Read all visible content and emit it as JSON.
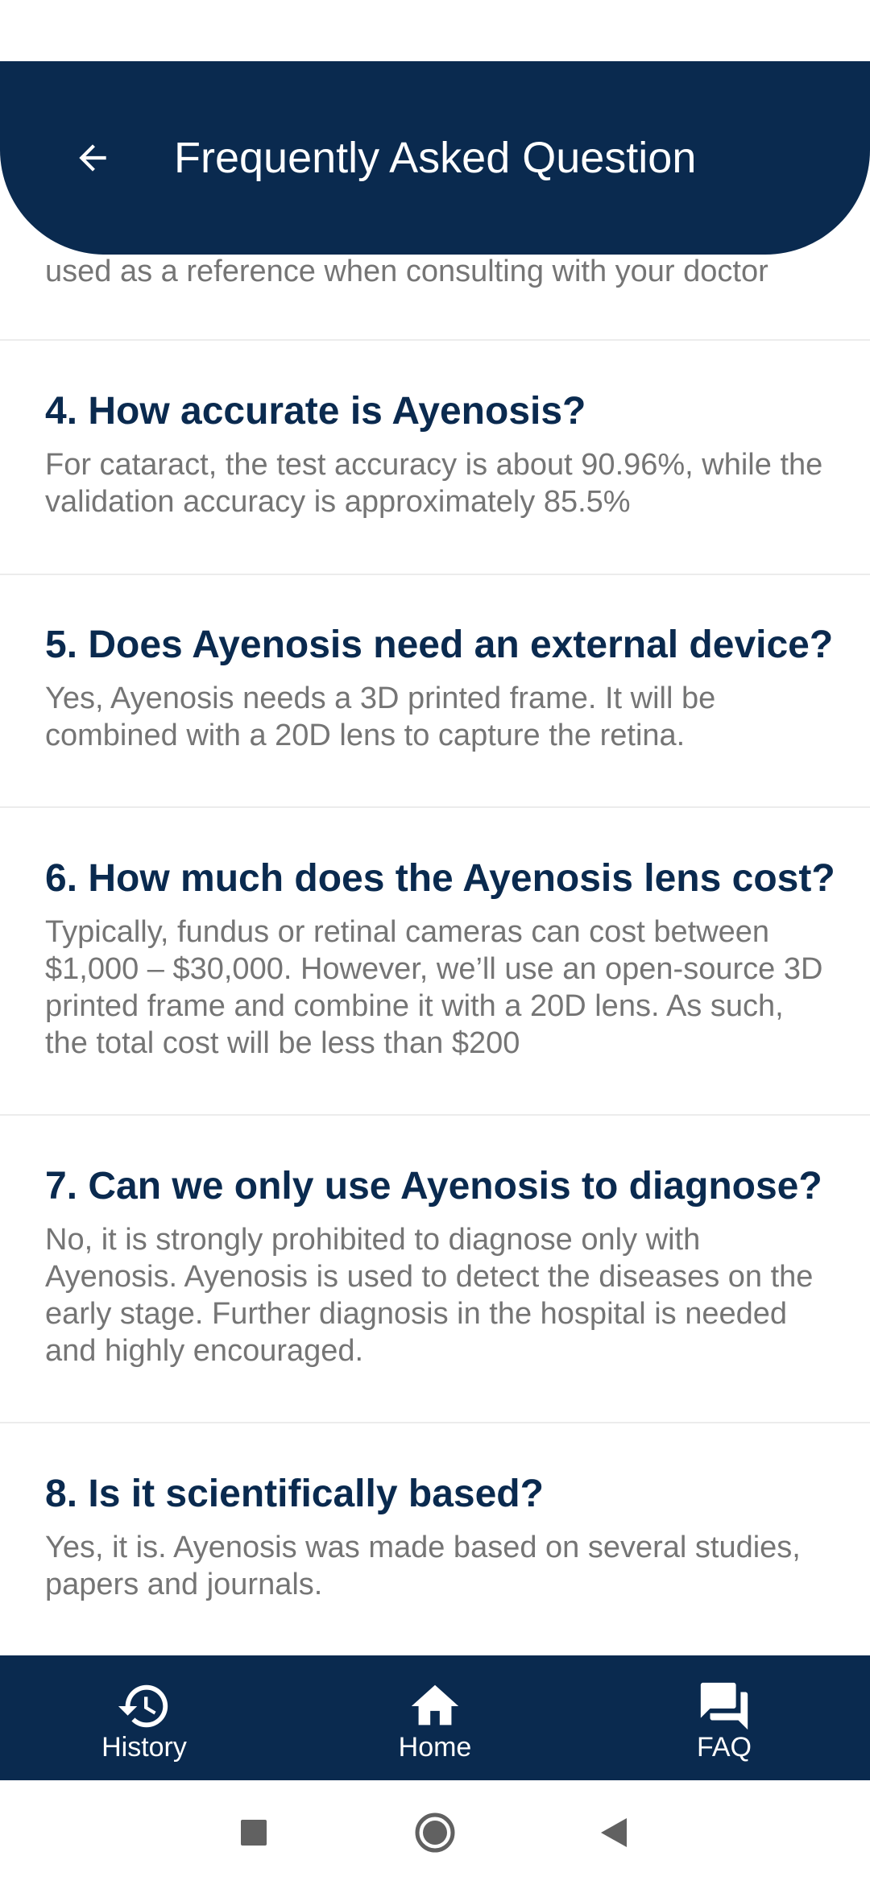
{
  "header": {
    "title": "Frequently Asked Question",
    "back_icon": "arrow-left-icon"
  },
  "partial_answer": "used as a reference when consulting with your doctor",
  "faq": [
    {
      "question": "4. How accurate is Ayenosis?",
      "answer": "For cataract, the test accuracy is about 90.96%, while the validation accuracy is approximately 85.5%"
    },
    {
      "question": "5. Does Ayenosis need an external device?",
      "answer": "Yes, Ayenosis needs a 3D printed frame. It will be combined with a 20D lens to capture the retina."
    },
    {
      "question": "6. How much does the Ayenosis lens cost?",
      "answer": "Typically, fundus or retinal cameras can cost between $1,000 – $30,000. However, we’ll use an open-source 3D printed frame and combine it with a 20D lens. As such, the total cost will be less than $200"
    },
    {
      "question": "7. Can we only use Ayenosis to diagnose?",
      "answer": "No, it is strongly prohibited to diagnose only with Ayenosis. Ayenosis is used to detect the diseases on the early stage. Further diagnosis in the hospital is needed and highly encouraged."
    },
    {
      "question": "8. Is it scientifically based?",
      "answer": "Yes, it is. Ayenosis was made based on several studies, papers and journals."
    }
  ],
  "bottom_nav": {
    "items": [
      {
        "label": "History",
        "icon": "history-icon"
      },
      {
        "label": "Home",
        "icon": "home-icon"
      },
      {
        "label": "FAQ",
        "icon": "forum-icon"
      }
    ]
  },
  "colors": {
    "primary": "#0a2a4f",
    "answer_text": "#757575",
    "background": "#ffffff"
  }
}
